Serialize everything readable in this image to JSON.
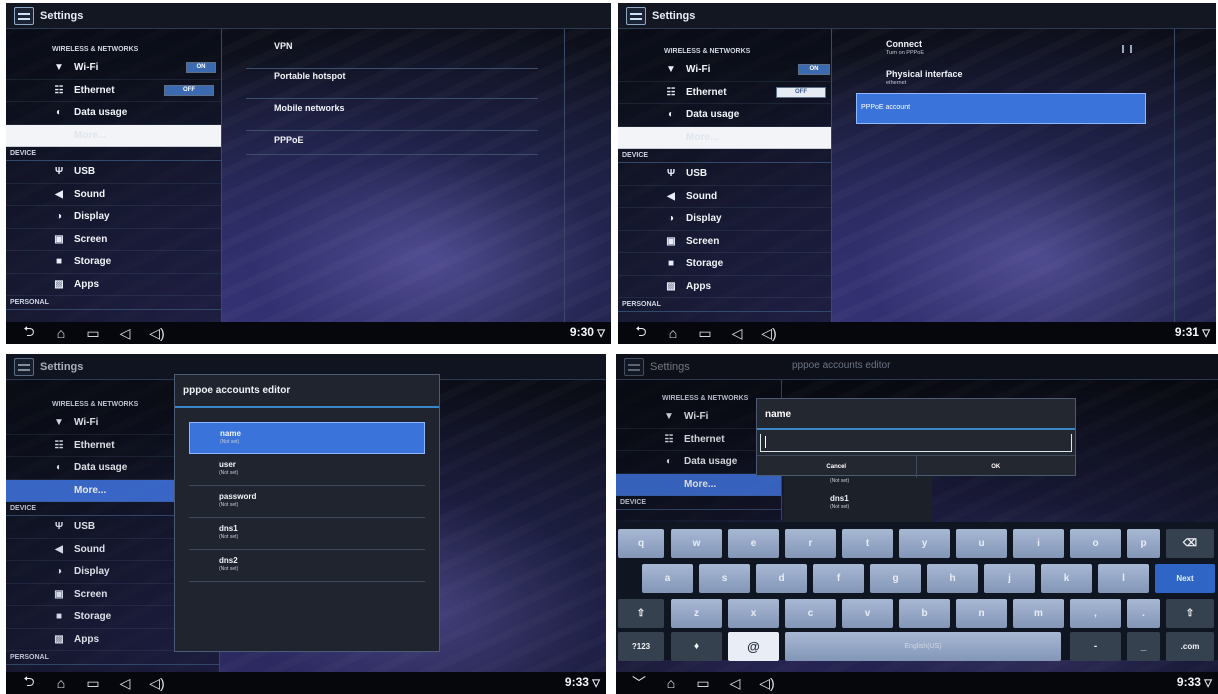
{
  "settings_title": "Settings",
  "section_wireless": "WIRELESS & NETWORKS",
  "section_device": "DEVICE",
  "section_personal": "PERSONAL",
  "menu": {
    "wifi": "Wi-Fi",
    "ethernet": "Ethernet",
    "data_usage": "Data usage",
    "more": "More...",
    "usb": "USB",
    "sound": "Sound",
    "display": "Display",
    "screen": "Screen",
    "storage": "Storage",
    "apps": "Apps"
  },
  "toggles": {
    "on": "ON",
    "off": "OFF"
  },
  "icons": {
    "wifi": "wifi-icon",
    "ethernet": "ethernet-icon",
    "data_usage": "data-usage-icon",
    "usb": "usb-icon",
    "sound": "sound-icon",
    "display": "display-icon",
    "screen": "screen-icon",
    "storage": "storage-icon",
    "apps": "apps-icon",
    "back": "back-icon",
    "home": "home-icon",
    "recents": "recents-icon",
    "vol_down": "volume-down-icon",
    "vol_up": "volume-up-icon",
    "status": "wifi-status-icon",
    "hide_kb": "hide-keyboard-icon"
  },
  "panel1": {
    "items": [
      "VPN",
      "Portable hotspot",
      "Mobile networks",
      "PPPoE"
    ],
    "time": "9:30"
  },
  "panel2": {
    "connect": {
      "label": "Connect",
      "sub": "Turn on PPPoE"
    },
    "physical": {
      "label": "Physical interface",
      "sub": "ethernet"
    },
    "account_button": "PPPoE account",
    "time": "9:31"
  },
  "panel3": {
    "dialog_title": "pppoe accounts editor",
    "entries": [
      {
        "label": "name",
        "sub": "(Not set)"
      },
      {
        "label": "user",
        "sub": "(Not set)"
      },
      {
        "label": "password",
        "sub": "(Not set)"
      },
      {
        "label": "dns1",
        "sub": "(Not set)"
      },
      {
        "label": "dns2",
        "sub": "(Not set)"
      }
    ],
    "time": "9:33"
  },
  "panel4": {
    "bg_title": "pppoe accounts editor",
    "dialog_title": "name",
    "input_value": "",
    "cancel": "Cancel",
    "ok": "OK",
    "behind": [
      {
        "label": "",
        "sub": "(Not set)"
      },
      {
        "label": "dns1",
        "sub": "(Not set)"
      }
    ],
    "keys_row1": [
      "q",
      "w",
      "e",
      "r",
      "t",
      "y",
      "u",
      "i",
      "o",
      "p"
    ],
    "keys_row2": [
      "a",
      "s",
      "d",
      "f",
      "g",
      "h",
      "j",
      "k",
      "l"
    ],
    "keys_row3": [
      "z",
      "x",
      "c",
      "v",
      "b",
      "n",
      "m",
      ",",
      "."
    ],
    "key_next": "Next",
    "key_123": "?123",
    "key_at": "@",
    "key_space": "English(US)",
    "key_dash": "-",
    "key_underscore": "_",
    "key_com": ".com",
    "time": "9:33"
  }
}
